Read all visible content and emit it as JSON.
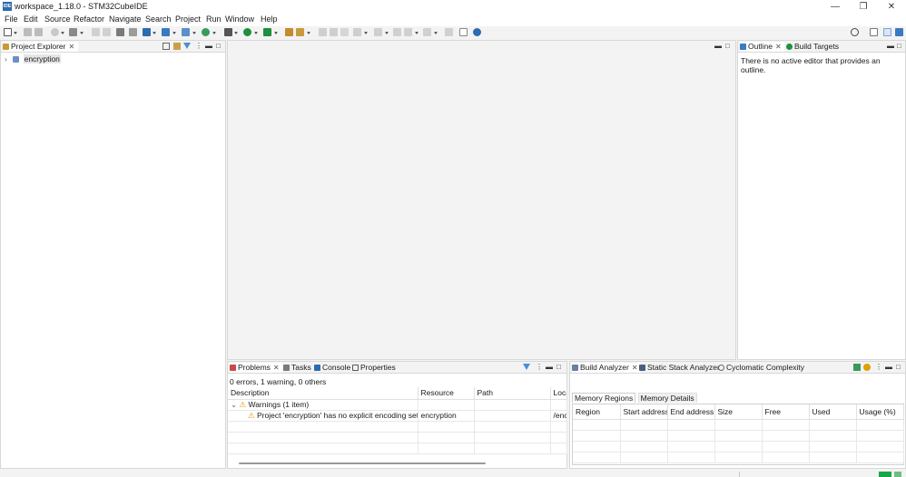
{
  "window": {
    "title": "workspace_1.18.0 - STM32CubeIDE",
    "app_icon_text": "IDE",
    "controls": [
      "—",
      "❐",
      "✕"
    ]
  },
  "menu": [
    "File",
    "Edit",
    "Source",
    "Refactor",
    "Navigate",
    "Search",
    "Project",
    "Run",
    "Window",
    "Help"
  ],
  "project_explorer": {
    "tab_label": "Project Explorer",
    "tree": [
      {
        "label": "encryption",
        "expanded": false,
        "icon": "ide-project-icon"
      }
    ]
  },
  "outline": {
    "tabs": [
      "Outline",
      "Build Targets"
    ],
    "message": "There is no active editor that provides an outline."
  },
  "problems": {
    "tabs": [
      "Problems",
      "Tasks",
      "Console",
      "Properties"
    ],
    "summary": "0 errors, 1 warning, 0 others",
    "columns": [
      "Description",
      "Resource",
      "Path",
      "Loca"
    ],
    "group_label": "Warnings (1 item)",
    "rows": [
      {
        "description": "Project 'encryption' has no explicit encoding set",
        "resource": "encryption",
        "path": "",
        "location": "/enc"
      }
    ]
  },
  "build_analyzer": {
    "tabs": [
      "Build Analyzer",
      "Static Stack Analyzer",
      "Cyclomatic Complexity"
    ],
    "subtabs": [
      "Memory Regions",
      "Memory Details"
    ],
    "columns": [
      "Region",
      "Start address",
      "End address",
      "Size",
      "Free",
      "Used",
      "Usage (%)"
    ]
  },
  "colors": {
    "accent": "#2b6cb0",
    "warning": "#e0a000",
    "status_green": "#19a64a"
  }
}
